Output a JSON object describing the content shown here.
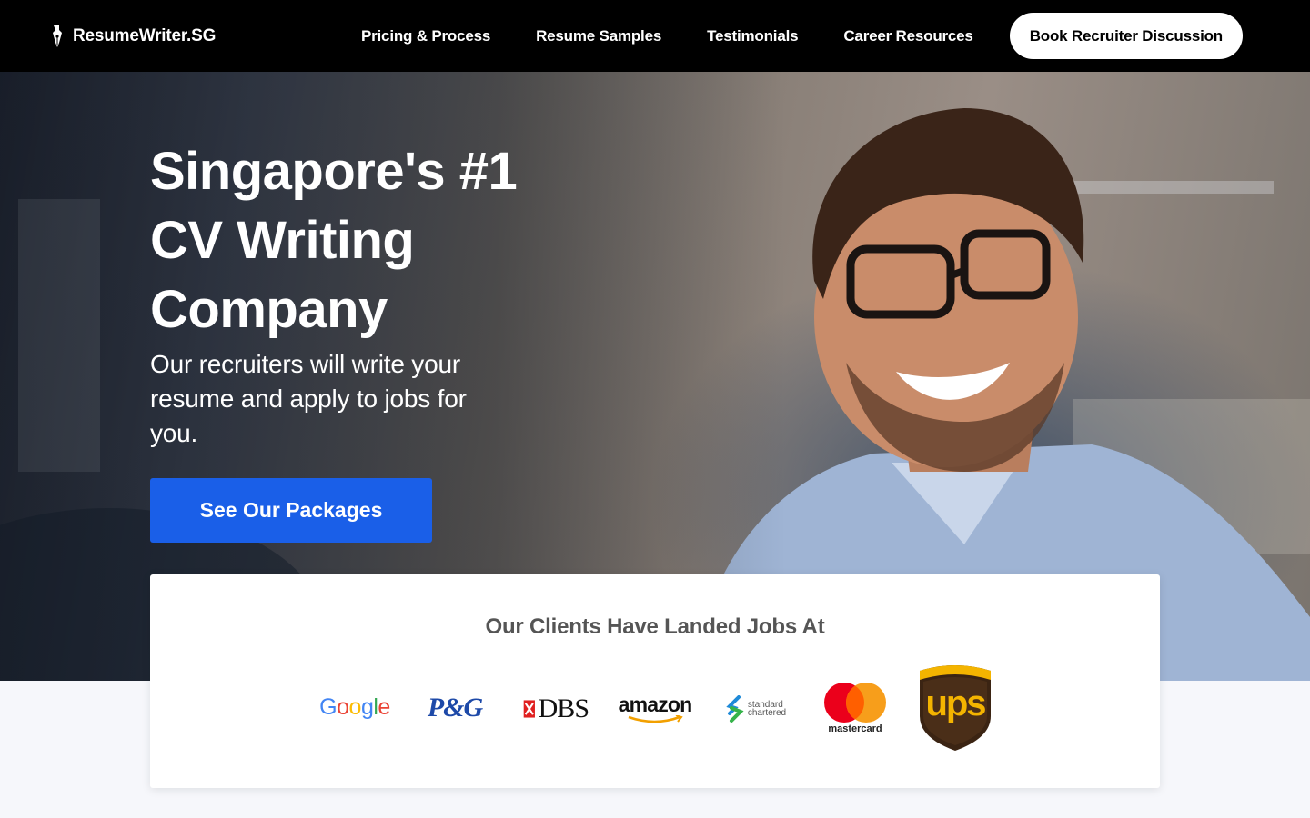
{
  "brand": {
    "name": "ResumeWriter.SG",
    "icon": "pen-nib-icon"
  },
  "nav": {
    "links": [
      "Pricing & Process",
      "Resume Samples",
      "Testimonials",
      "Career Resources"
    ],
    "cta": "Book Recruiter Discussion"
  },
  "hero": {
    "title_line1": "Singapore's #1",
    "title_line2": "CV Writing",
    "title_line3": "Company",
    "subtitle": "Our recruiters will write your resume and apply to jobs for you.",
    "button": "See Our Packages"
  },
  "clients": {
    "title": "Our Clients Have Landed Jobs At",
    "logos": {
      "google": "Google",
      "pg": "P&G",
      "dbs": "DBS",
      "amazon": "amazon",
      "sc_line1": "standard",
      "sc_line2": "chartered",
      "mastercard": "mastercard",
      "ups": "ups"
    }
  },
  "colors": {
    "topbar": "#000000",
    "primary_button": "#1a5fe8",
    "page_bg": "#f6f7fb"
  }
}
